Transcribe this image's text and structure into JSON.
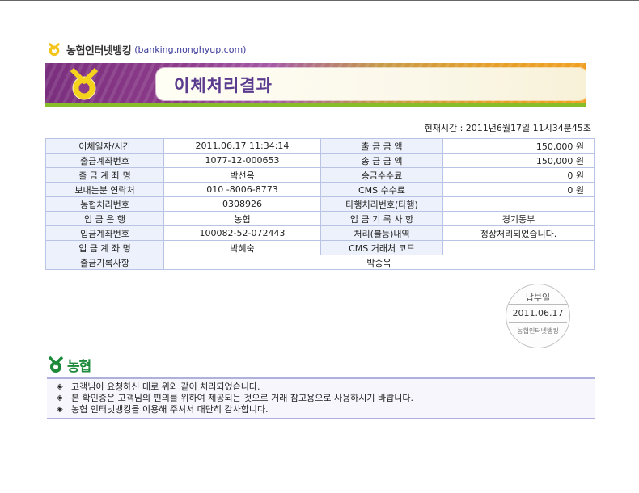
{
  "brand": {
    "name": "농협인터넷뱅킹",
    "url": "(banking.nonghyup.com)"
  },
  "banner": {
    "title": "이체처리결과"
  },
  "current_time": "현재시간 : 2011년6월17일 11시34분45초",
  "table": {
    "rows": [
      {
        "l1": "이체일자/시간",
        "v1": "2011.06.17 11:34:14",
        "l2": "출 금 금 액",
        "v2": "150,000 원"
      },
      {
        "l1": "출금계좌번호",
        "v1": "1077-12-000653",
        "l2": "송 금 금 액",
        "v2": "150,000 원"
      },
      {
        "l1": "출 금 계 좌 명",
        "v1": "박선옥",
        "l2": "송금수수료",
        "v2": "0 원"
      },
      {
        "l1": "보내는분 연락처",
        "v1": "010 -8006-8773",
        "l2": "CMS 수수료",
        "v2": "0 원"
      },
      {
        "l1": "농협처리번호",
        "v1": "0308926",
        "l2": "타행처리번호(타행)",
        "v2": ""
      },
      {
        "l1": "입  금  은  행",
        "v1": "농협",
        "l2": "입 금 기 록 사 항",
        "v2": "경기동부"
      },
      {
        "l1": "입금계좌번호",
        "v1": "100082-52-072443",
        "l2": "처리(불능)내역",
        "v2": "정상처리되었습니다."
      },
      {
        "l1": "입 금 계 좌 명",
        "v1": "박혜숙",
        "l2": "CMS 거래처 코드",
        "v2": ""
      }
    ],
    "memo_label": "출금기록사항",
    "memo_value": "박종옥"
  },
  "stamp": {
    "top": "납부일",
    "date": "2011.06.17",
    "bottom": "농협인터넷뱅킹"
  },
  "footer": {
    "logo_text": "농협",
    "notes": [
      "고객님이 요청하신 대로 위와 같이 처리되었습니다.",
      "본 확인증은 고객님의 편의를 위하여 제공되는 것으로 거래 참고용으로 사용하시기 바랍니다.",
      "농협 인터넷뱅킹을 이용해 주셔서 대단히 감사합니다."
    ]
  },
  "colors": {
    "brand_green": "#1c8a3a",
    "banner_purple": "#7a2f7e",
    "banner_orange": "#f0a020",
    "title_text": "#5a3a8e",
    "label_bg": "#edf1fb",
    "border": "#b9c3e6"
  },
  "icons": {
    "brand_logo": "nonghyup-logo-icon",
    "bullet": "diamond-bullet-icon"
  }
}
